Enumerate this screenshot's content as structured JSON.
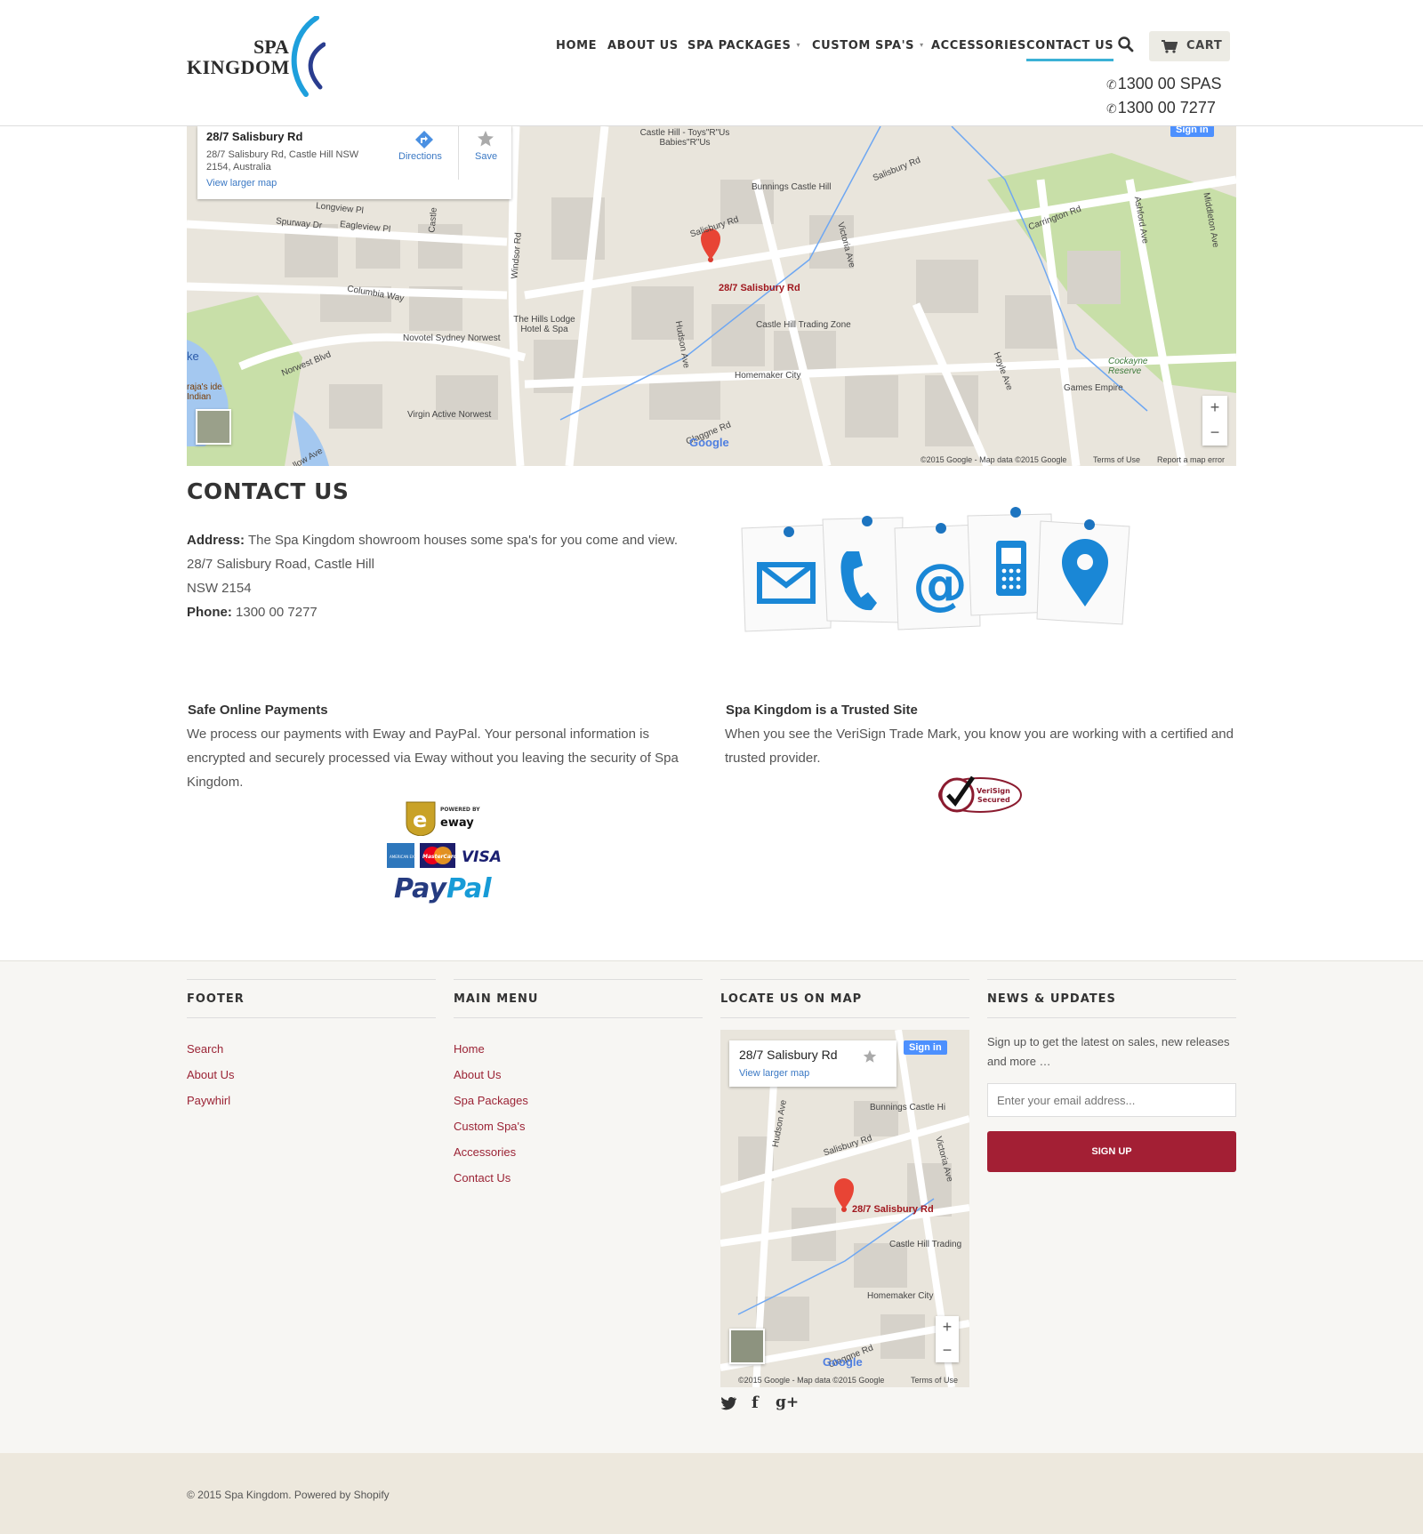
{
  "brand": {
    "line1": "SPA",
    "line2": "KINGDOM"
  },
  "nav": {
    "home": "HOME",
    "about": "ABOUT US",
    "packages": "SPA PACKAGES",
    "custom": "CUSTOM SPA'S",
    "accessories": "ACCESSORIES",
    "contact": "CONTACT US",
    "cart": "CART",
    "caret": "▾"
  },
  "phones": {
    "icon": "✆",
    "line1": "1300 00 SPAS",
    "line2": "1300 00 7277"
  },
  "map": {
    "card_title": "28/7 Salisbury Rd",
    "card_address": "28/7 Salisbury Rd, Castle Hill NSW 2154, Australia",
    "view_larger": "View larger map",
    "directions": "Directions",
    "save": "Save",
    "sign_in": "Sign in",
    "marker_label": "28/7 Salisbury Rd",
    "labels": {
      "toys": "Castle Hill - Toys\"R\"Us Babies\"R\"Us",
      "bunnings": "Bunnings Castle Hill",
      "salisbury1": "Salisbury Rd",
      "salisbury2": "Salisbury Rd",
      "carrington": "Carrington Rd",
      "longview": "Longview Pl",
      "spurway": "Spurway Dr",
      "eaglevi": "Eagleview Pl",
      "columbia": "Columbia Way",
      "hillslodge": "The Hills Lodge Hotel & Spa",
      "novotel": "Novotel Sydney Norwest",
      "norwest": "Norwest Blvd",
      "virgin": "Virgin Active Norwest",
      "trading": "Castle Hill Trading Zone",
      "homemaker": "Homemaker City",
      "games": "Games Empire",
      "cockayne": "Cockayne Reserve",
      "ashford": "Ashford Ave",
      "middleton": "Middleton Ave",
      "hoyle": "Hoyle Ave",
      "hudson": "Hudson Ave",
      "windsor": "Windsor Rd",
      "victoria": "Victoria Ave",
      "castle": "Castle",
      "lake": "ke",
      "raja": "raja's ide Indian",
      "willow": "llow Ave",
      "gladstone": "Glaggne Rd",
      "google": "Google",
      "credits": "©2015 Google - Map data ©2015 Google",
      "terms": "Terms of Use",
      "report": "Report a map error"
    }
  },
  "contact": {
    "title": "CONTACT US",
    "address_label": "Address:",
    "address_text": "The Spa Kingdom showroom houses some spa's for you come and view.",
    "line2": "28/7 Salisbury Road, Castle Hill",
    "line3": "NSW 2154",
    "phone_label": "Phone:",
    "phone_value": "1300 00 7277"
  },
  "payments": {
    "heading": "Safe Online Payments",
    "text": "We process our payments with Eway and PayPal. Your personal information is encrypted and securely processed via Eway without you leaving the security of Spa Kingdom.",
    "eway_powered": "POWERED BY",
    "eway_name": "eway",
    "amex": "AMERICAN EXPRESS",
    "mastercard": "MasterCard",
    "visa": "VISA",
    "paypal_a": "Pay",
    "paypal_b": "Pal"
  },
  "trusted": {
    "heading": "Spa Kingdom is a Trusted Site",
    "text": "When you see the VeriSign Trade Mark, you know you are working with a certified and trusted provider.",
    "badge_line1": "VeriSign",
    "badge_line2": "Secured"
  },
  "footer": {
    "col1": {
      "heading": "FOOTER",
      "items": [
        "Search",
        "About Us",
        "Paywhirl"
      ]
    },
    "col2": {
      "heading": "MAIN MENU",
      "items": [
        "Home",
        "About Us",
        "Spa Packages",
        "Custom Spa's",
        "Accessories",
        "Contact Us"
      ]
    },
    "col3": {
      "heading": "LOCATE US ON MAP",
      "card_title": "28/7 Salisbury Rd",
      "view_larger": "View larger map",
      "sign_in": "Sign in",
      "marker_label": "28/7 Salisbury Rd",
      "labels": {
        "bunnings": "Bunnings Castle Hi",
        "salisbury": "Salisbury Rd",
        "victoria": "Victoria Ave",
        "hudson": "Hudson Ave",
        "trading": "Castle Hill Trading",
        "homemaker": "Homemaker City",
        "gladstone": "Glaggne Rd",
        "google": "Google",
        "credits": "©2015 Google - Map data ©2015 Google",
        "terms": "Terms of Use"
      }
    },
    "col4": {
      "heading": "NEWS & UPDATES",
      "text": "Sign up to get the latest on sales, new releases and more …",
      "placeholder": "Enter your email address...",
      "button": "SIGN UP"
    }
  },
  "social": {
    "twitter": "twitter-icon",
    "facebook": "facebook-icon",
    "gplus": "google-plus-icon",
    "fb_glyph": "f",
    "gp_glyph": "g+"
  },
  "copyright": "© 2015 Spa Kingdom. Powered by Shopify"
}
